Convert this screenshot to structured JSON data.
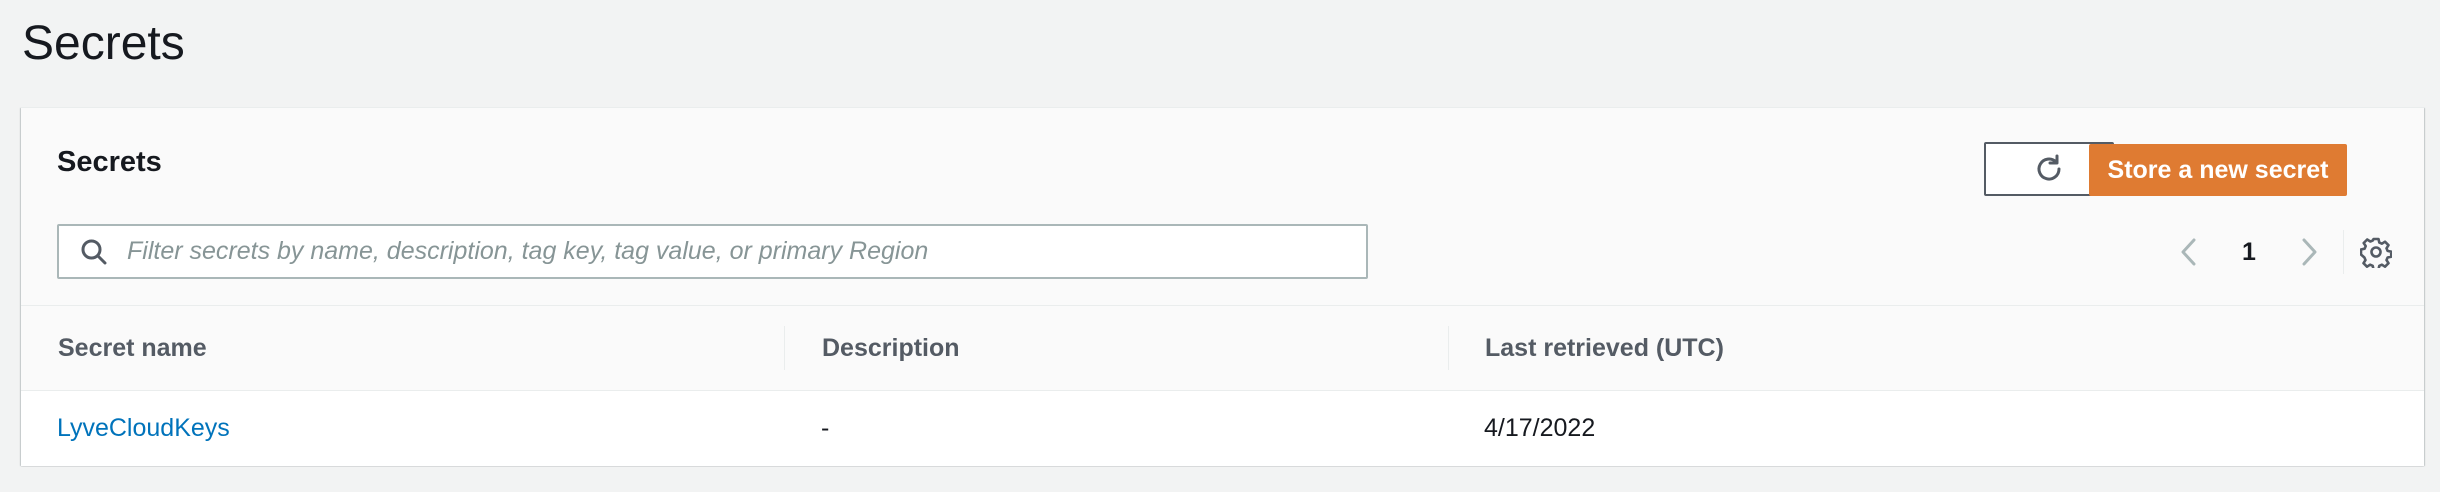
{
  "page": {
    "title": "Secrets"
  },
  "panel": {
    "title": "Secrets",
    "store_button_label": "Store a new secret",
    "search_placeholder": "Filter secrets by name, description, tag key, tag value, or primary Region",
    "pagination": {
      "current_page": "1"
    }
  },
  "table": {
    "columns": [
      "Secret name",
      "Description",
      "Last retrieved (UTC)"
    ],
    "rows": [
      {
        "secret_name": "LyveCloudKeys",
        "description": "-",
        "last_retrieved": "4/17/2022"
      }
    ]
  },
  "colors": {
    "primary_button": "#df7b32",
    "link": "#0073bb",
    "background": "#f2f3f3"
  },
  "icons": {
    "refresh": "refresh-icon",
    "search": "search-icon",
    "prev": "chevron-left-icon",
    "next": "chevron-right-icon",
    "settings": "gear-icon"
  }
}
